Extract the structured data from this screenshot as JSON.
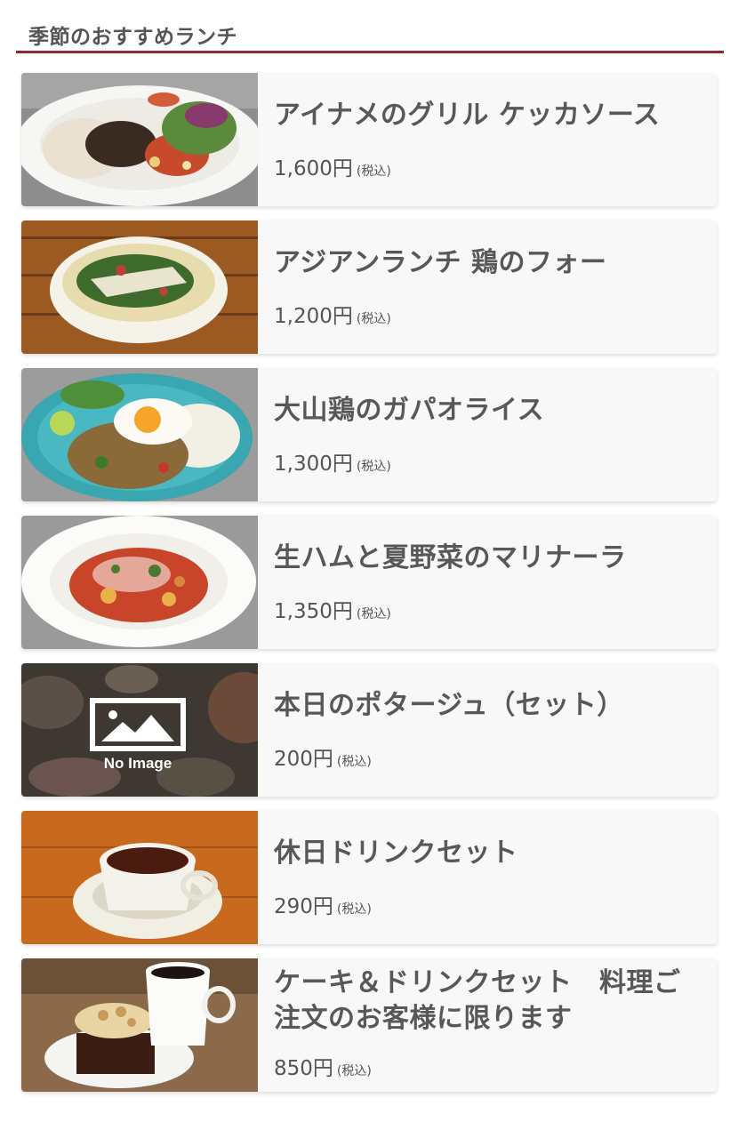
{
  "section": {
    "title": "季節のおすすめランチ"
  },
  "colors": {
    "accent_rule": "#8b2a35",
    "card_bg": "#f8f8f8",
    "text": "#555555"
  },
  "menu_items": [
    {
      "name": "アイナメのグリル ケッカソース",
      "price": "1,600円",
      "tax": "(税込)",
      "image": "grilled-fish-rice-plate-photo"
    },
    {
      "name": "アジアンランチ 鶏のフォー",
      "price": "1,200円",
      "tax": "(税込)",
      "image": "chicken-pho-bowl-photo"
    },
    {
      "name": "大山鶏のガパオライス",
      "price": "1,300円",
      "tax": "(税込)",
      "image": "gapao-rice-plate-photo"
    },
    {
      "name": "生ハムと夏野菜のマリナーラ",
      "price": "1,350円",
      "tax": "(税込)",
      "image": "prosciutto-pasta-photo"
    },
    {
      "name": "本日のポタージュ（セット）",
      "price": "200円",
      "tax": "(税込)",
      "image": "no-image-placeholder",
      "placeholder_text": "No Image"
    },
    {
      "name": "休日ドリンクセット",
      "price": "290円",
      "tax": "(税込)",
      "image": "coffee-cup-photo"
    },
    {
      "name": "ケーキ＆ドリンクセット　料理ご注文のお客様に限ります",
      "price": "850円",
      "tax": "(税込)",
      "image": "cake-and-coffee-photo"
    }
  ]
}
